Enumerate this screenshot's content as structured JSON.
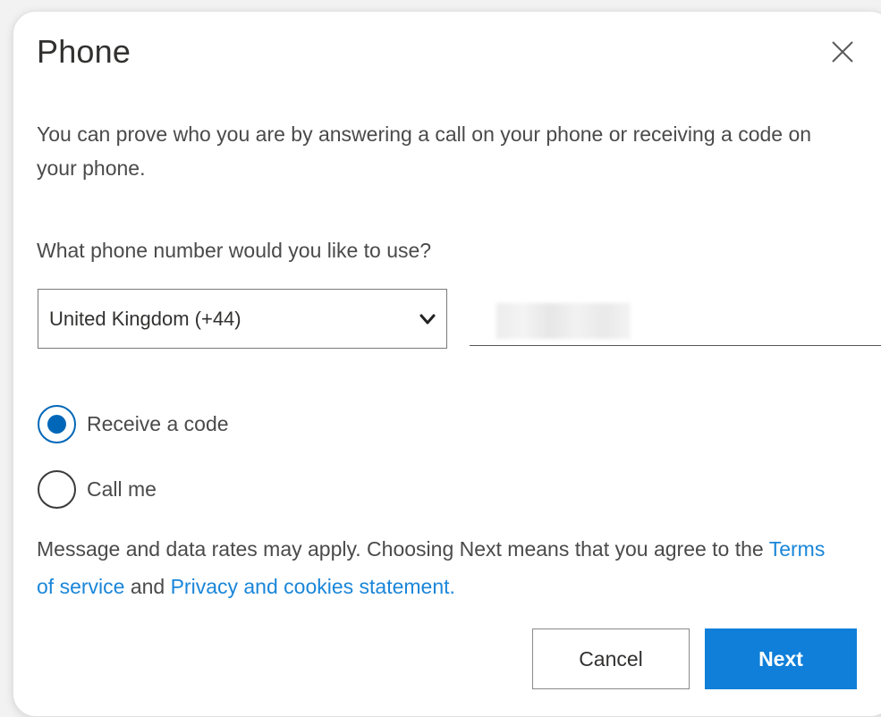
{
  "dialog": {
    "title": "Phone",
    "close_icon": "close-icon",
    "description": "You can prove who you are by answering a call on your phone or receiving a code on your phone.",
    "question": "What phone number would you like to use?",
    "country_select": {
      "selected": "United Kingdom (+44)",
      "icon": "chevron-down-icon"
    },
    "phone_input": {
      "value": ""
    },
    "options": [
      {
        "label": "Receive a code",
        "checked": true
      },
      {
        "label": "Call me",
        "checked": false
      }
    ],
    "legal": {
      "prefix": "Message and data rates may apply. Choosing Next means that you agree to the ",
      "terms_link": "Terms of service",
      "middle": " and ",
      "privacy_link": "Privacy and cookies statement."
    },
    "buttons": {
      "cancel": "Cancel",
      "next": "Next"
    },
    "colors": {
      "accent": "#0f7fd9",
      "link": "#1a86d9",
      "radio_checked": "#0067b8"
    }
  }
}
